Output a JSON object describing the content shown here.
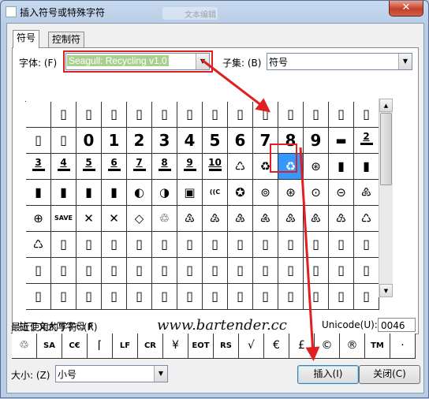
{
  "window": {
    "title": "插入符号或特殊字符",
    "close_glyph": "✕",
    "ghost_text": "文本编辑"
  },
  "tabs": [
    "符号",
    "控制符"
  ],
  "font": {
    "label": "字体:",
    "hotkey": "(F)",
    "value": "Seagull: Recycling v1.0"
  },
  "subset": {
    "label": "子集:",
    "hotkey": "(B)",
    "value": "符号"
  },
  "grid": {
    "rows": [
      [
        "",
        "▯",
        "▯",
        "▯",
        "▯",
        "▯",
        "▯",
        "▯",
        "▯",
        "▯",
        "▯",
        "▯",
        "▯",
        "▯"
      ],
      [
        "▯",
        "▯",
        "0",
        "1",
        "2",
        "3",
        "4",
        "5",
        "6",
        "7",
        "8",
        "9",
        "▬",
        "2"
      ],
      [
        "3",
        "4",
        "5",
        "6",
        "7",
        "8",
        "9",
        "10",
        "♺",
        "♻",
        "♻",
        "⊛",
        "▮",
        "▮"
      ],
      [
        "▮",
        "▮",
        "▮",
        "▮",
        "◐",
        "◑",
        "▣",
        "((C",
        "✪",
        "⊚",
        "⊛",
        "⊙",
        "⊝",
        "♸"
      ],
      [
        "⊕",
        "SAVE",
        "✕",
        "✕",
        "◇",
        "♲",
        "♳",
        "♴",
        "♵",
        "♶",
        "♷",
        "♸",
        "♹",
        "♺"
      ],
      [
        "♺",
        "▯",
        "▯",
        "▯",
        "▯",
        "▯",
        "▯",
        "▯",
        "▯",
        "▯",
        "▯",
        "▯",
        "▯",
        "▯"
      ],
      [
        "▯",
        "▯",
        "▯",
        "▯",
        "▯",
        "▯",
        "▯",
        "▯",
        "▯",
        "▯",
        "▯",
        "▯",
        "▯",
        "▯"
      ],
      [
        "▯",
        "▯",
        "▯",
        "▯",
        "▯",
        "▯",
        "▯",
        "▯",
        "▯",
        "▯",
        "▯",
        "▯",
        "▯",
        "▯"
      ]
    ],
    "selected_row": 2,
    "selected_col": 10
  },
  "char_name": "拉丁文大写字母 F",
  "unicode": {
    "label": "Unicode(U):",
    "value": "0046"
  },
  "recent": {
    "label": "最近使用的字符:",
    "hotkey": "(R)",
    "items": [
      "♲",
      "SA",
      "C€",
      "⌈",
      "LF",
      "CR",
      "¥",
      "EOT",
      "RS",
      "√",
      "€",
      "£",
      "©",
      "®",
      "TM",
      "·"
    ]
  },
  "watermark": "www.bartender.cc",
  "size": {
    "label": "大小:",
    "hotkey": "(Z)",
    "value": "小号"
  },
  "buttons": {
    "insert": "插入(I)",
    "close": "关闭(C)"
  },
  "colors": {
    "highlight": "#e02020",
    "selection": "#3399ff",
    "font_highlight": "#a9d08e"
  }
}
